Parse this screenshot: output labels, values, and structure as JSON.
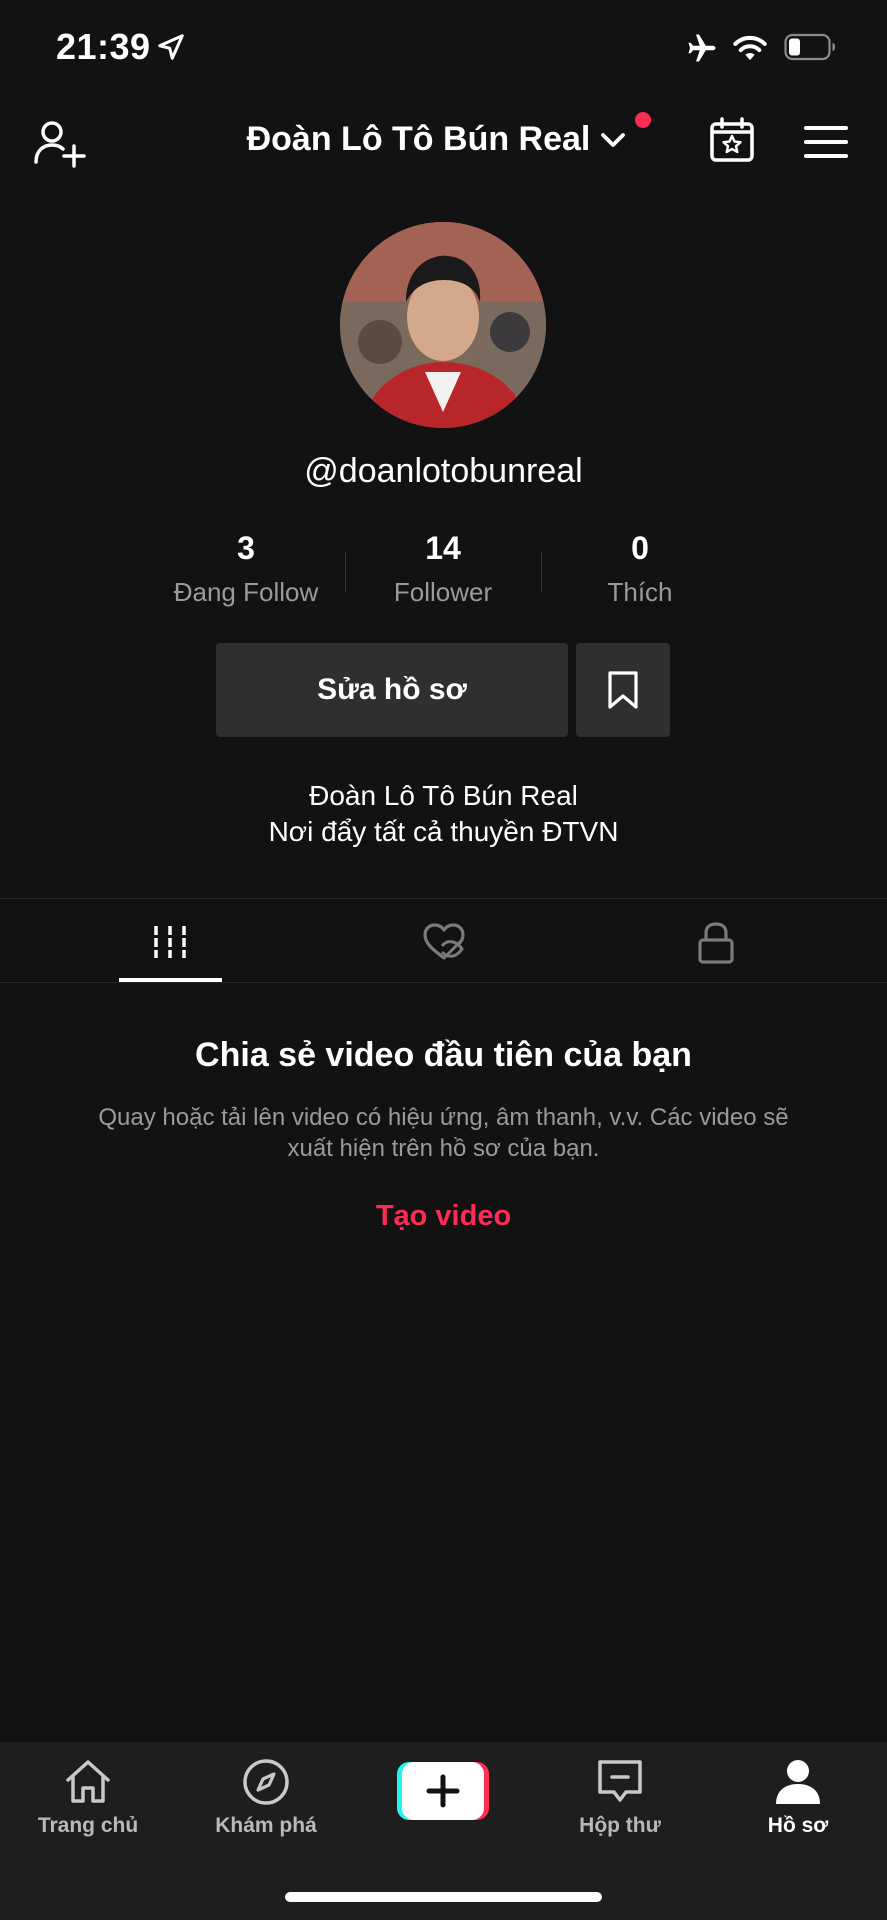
{
  "status_bar": {
    "time": "21:39"
  },
  "header": {
    "account_name": "Đoàn Lô Tô Bún Real"
  },
  "profile": {
    "username": "@doanlotobunreal",
    "stats": [
      {
        "value": "3",
        "label": "Đang Follow"
      },
      {
        "value": "14",
        "label": "Follower"
      },
      {
        "value": "0",
        "label": "Thích"
      }
    ],
    "edit_button_label": "Sửa hồ sơ",
    "bio_line1": "Đoàn Lô Tô Bún Real",
    "bio_line2": "Nơi đẩy tất cả thuyền ĐTVN"
  },
  "tabs": [
    {
      "icon": "grid-icon",
      "active": true
    },
    {
      "icon": "liked-hidden-icon",
      "active": false
    },
    {
      "icon": "lock-icon",
      "active": false
    }
  ],
  "empty_state": {
    "title": "Chia sẻ video đầu tiên của bạn",
    "description": "Quay hoặc tải lên video có hiệu ứng, âm thanh, v.v. Các video sẽ xuất hiện trên hồ sơ của bạn.",
    "action": "Tạo video"
  },
  "bottom_nav": [
    {
      "label": "Trang chủ",
      "icon": "home-icon"
    },
    {
      "label": "Khám phá",
      "icon": "compass-icon"
    },
    {
      "label": "",
      "icon": "create-icon"
    },
    {
      "label": "Hộp thư",
      "icon": "inbox-icon"
    },
    {
      "label": "Hồ sơ",
      "icon": "profile-icon",
      "active": true
    }
  ],
  "colors": {
    "background": "#121212",
    "accent": "#fe2c55",
    "button": "#2f2f2f",
    "secondary_text": "#9a9a9a"
  }
}
